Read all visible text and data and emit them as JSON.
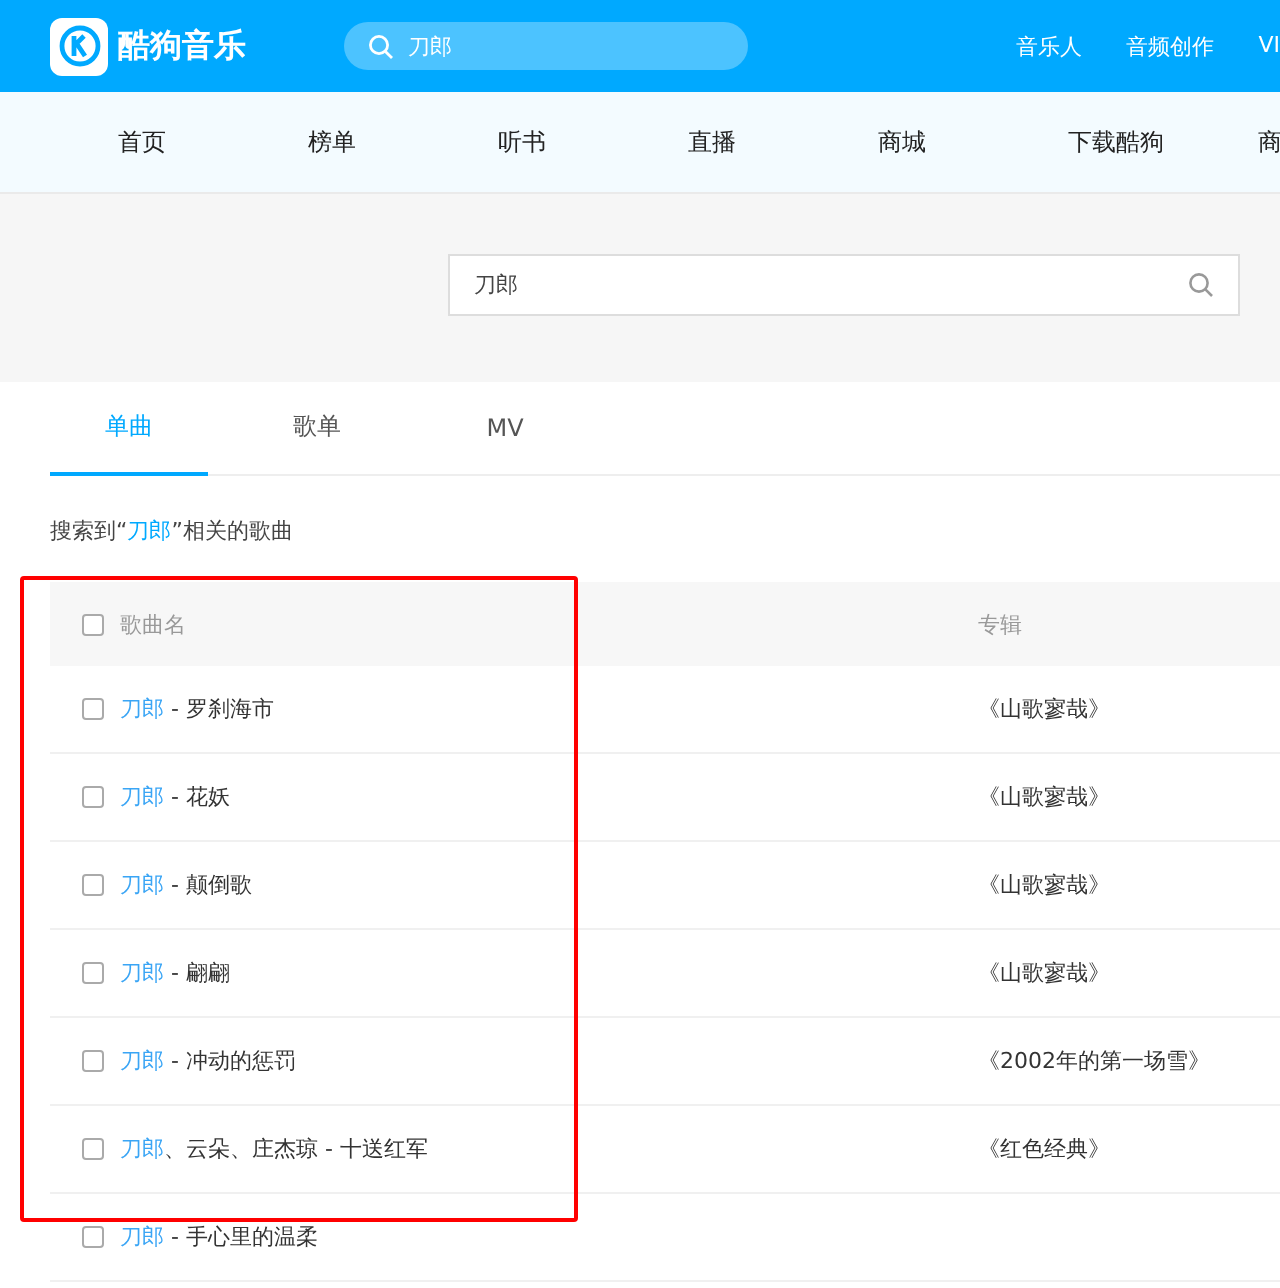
{
  "header": {
    "logo_text": "酷狗音乐",
    "search": {
      "value": "刀郎"
    },
    "links": [
      "音乐人",
      "音频创作",
      "VI"
    ]
  },
  "nav": [
    "首页",
    "榜单",
    "听书",
    "直播",
    "商城",
    "下载酷狗",
    "商"
  ],
  "search": {
    "value": "刀郎"
  },
  "tabs": [
    {
      "label": "单曲",
      "selected": true
    },
    {
      "label": "歌单",
      "selected": false
    },
    {
      "label": "MV",
      "selected": false
    }
  ],
  "result_note": "搜索到“**刀郎**”相关的歌曲",
  "table": {
    "columns": [
      "歌曲名",
      "专辑"
    ],
    "header_checked": false,
    "rows": [
      {
        "artist": "刀郎",
        "title": " - 罗刹海市",
        "album": "《山歌寥哉》",
        "checked": false
      },
      {
        "artist": "刀郎",
        "title": " - 花妖",
        "album": "《山歌寥哉》",
        "checked": false
      },
      {
        "artist": "刀郎",
        "title": " - 颠倒歌",
        "album": "《山歌寥哉》",
        "checked": false
      },
      {
        "artist": "刀郎",
        "title": " - 翩翩",
        "album": "《山歌寥哉》",
        "checked": false
      },
      {
        "artist": "刀郎",
        "title": " - 冲动的惩罚",
        "album": "《2002年的第一场雪》",
        "checked": false
      },
      {
        "artist": "刀郎",
        "title": "、云朵、庄杰琼 - 十送红军",
        "album": "《红色经典》",
        "checked": false
      },
      {
        "artist": "刀郎",
        "title": " - 手心里的温柔",
        "checked": false
      }
    ]
  },
  "annotation": {
    "kind": "highlight-box"
  }
}
